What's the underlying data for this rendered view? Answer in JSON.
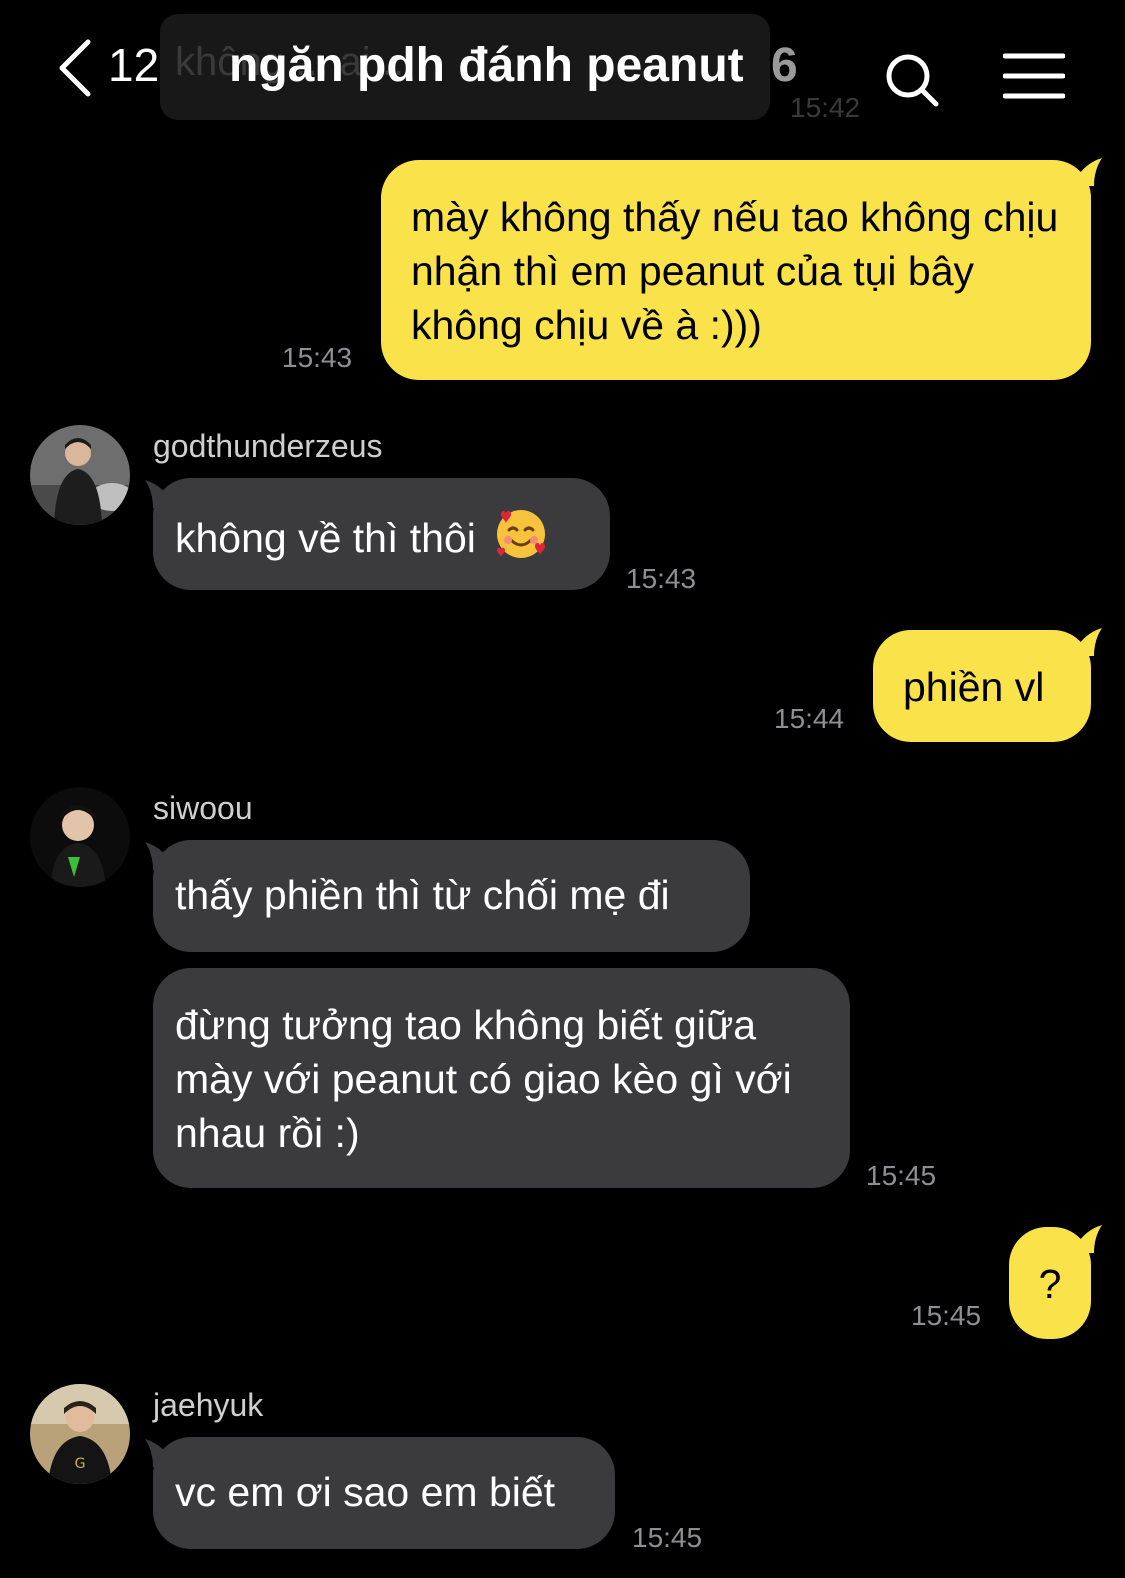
{
  "header": {
    "back_count": "12",
    "title": "ngăn pdh đánh peanut",
    "member_count": "6",
    "ghost_preview_text": "không ... ai ...",
    "ghost_preview_time": "15:42"
  },
  "messages": [
    {
      "type": "outgoing",
      "text": "mày không thấy nếu tao không chịu nhận thì em peanut của tụi bây không chịu về à :)))",
      "time": "15:43"
    },
    {
      "type": "incoming",
      "sender": "godthunderzeus",
      "text": "không về thì thôi",
      "emoji": "smiling-face-with-hearts",
      "time": "15:43"
    },
    {
      "type": "outgoing",
      "text": "phiền vl",
      "time": "15:44"
    },
    {
      "type": "incoming",
      "sender": "siwoou",
      "text": "thấy phiền thì từ chối mẹ đi"
    },
    {
      "type": "incoming",
      "text": "đừng tưởng tao không biết giữa mày với peanut có giao kèo gì với nhau rồi :)",
      "time": "15:45"
    },
    {
      "type": "outgoing",
      "text": "?",
      "time": "15:45"
    },
    {
      "type": "incoming",
      "sender": "jaehyuk",
      "text": "vc em ơi sao em biết",
      "time": "15:45"
    }
  ],
  "colors": {
    "outgoing_bubble": "#fae34a",
    "incoming_bubble": "#3b3b3d",
    "background": "#000000",
    "timestamp": "#8e8e93"
  }
}
